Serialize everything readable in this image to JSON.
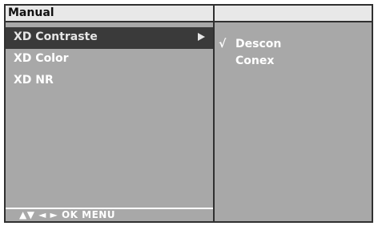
{
  "menu": {
    "title": "Manual",
    "items": [
      {
        "label": "XD Contraste",
        "selected": true
      },
      {
        "label": "XD Color"
      },
      {
        "label": "XD NR"
      }
    ],
    "navigation_hint": "▲▼  ◄ ►  OK  MENU"
  },
  "submenu": {
    "options": [
      {
        "check": "√",
        "label": "Descon"
      },
      {
        "check": "",
        "label": "Conex"
      }
    ]
  },
  "colors": {
    "panel": "#a8a8a8",
    "title_bar": "#e8e8e8",
    "selected_row": "#3a3a3a",
    "text": "#ffffff"
  }
}
